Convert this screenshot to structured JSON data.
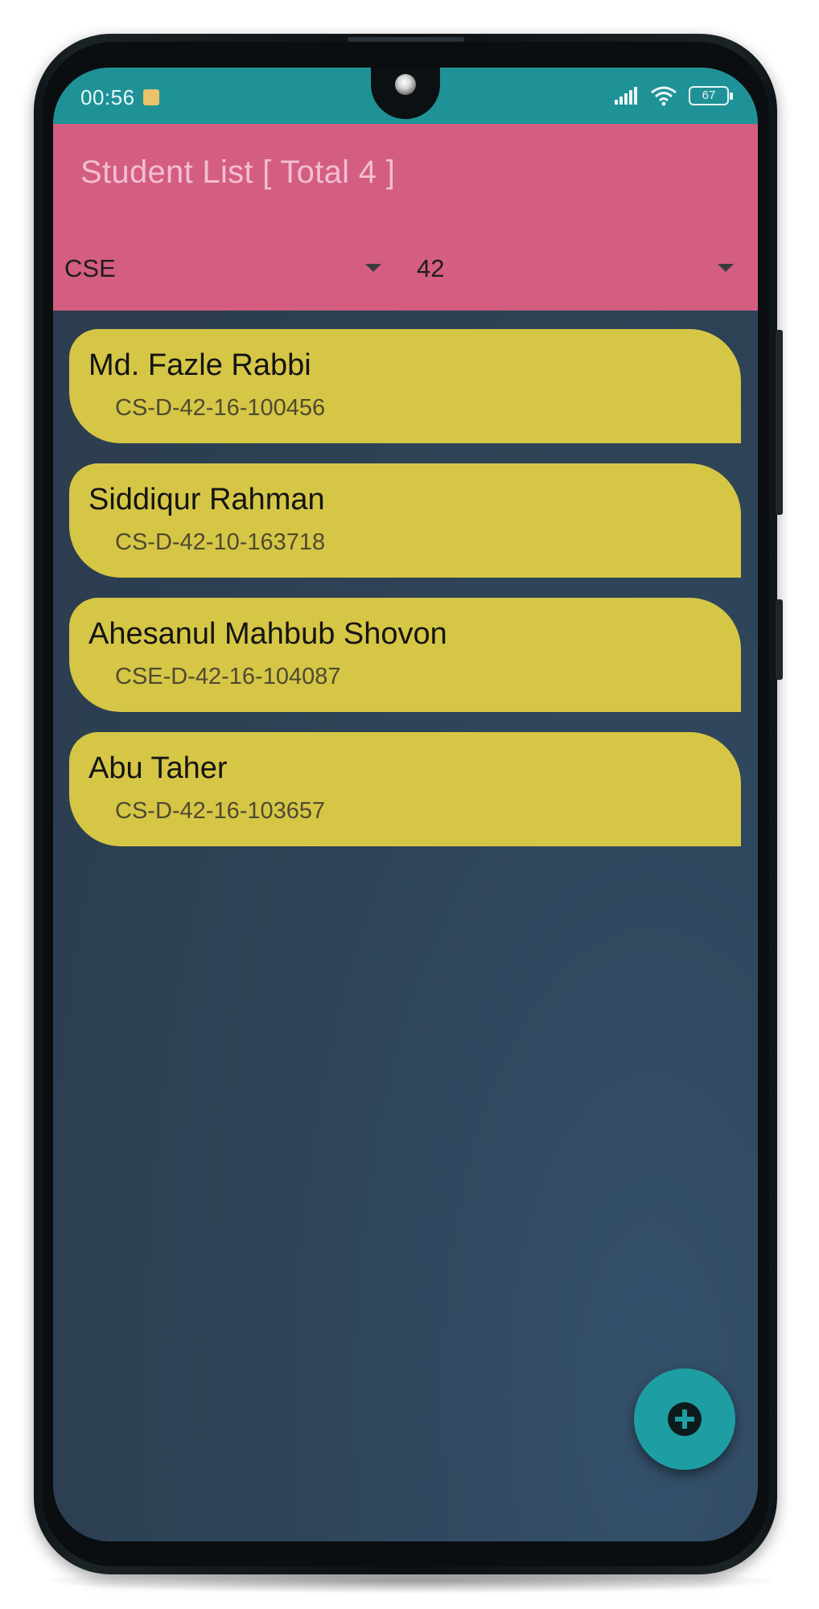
{
  "status_bar": {
    "time": "00:56",
    "battery": "67",
    "icons": [
      "notification-icon",
      "signal-icon",
      "wifi-icon",
      "battery-icon"
    ]
  },
  "app_bar": {
    "title": "Student List [ Total 4 ]",
    "department_dropdown": {
      "value": "CSE"
    },
    "batch_dropdown": {
      "value": "42"
    }
  },
  "students": [
    {
      "name": "Md. Fazle Rabbi",
      "id": "CS-D-42-16-100456"
    },
    {
      "name": "Siddiqur Rahman",
      "id": "CS-D-42-10-163718"
    },
    {
      "name": "Ahesanul Mahbub Shovon",
      "id": "CSE-D-42-16-104087"
    },
    {
      "name": "Abu Taher",
      "id": "CS-D-42-16-103657"
    }
  ],
  "fab": {
    "icon": "add-icon"
  },
  "colors": {
    "status_bar": "#1f9297",
    "app_bar": "#d45d82",
    "title_text": "#f2bfd0",
    "card": "#d6c646",
    "background": "#2c3e50",
    "fab": "#1e9ea2"
  }
}
